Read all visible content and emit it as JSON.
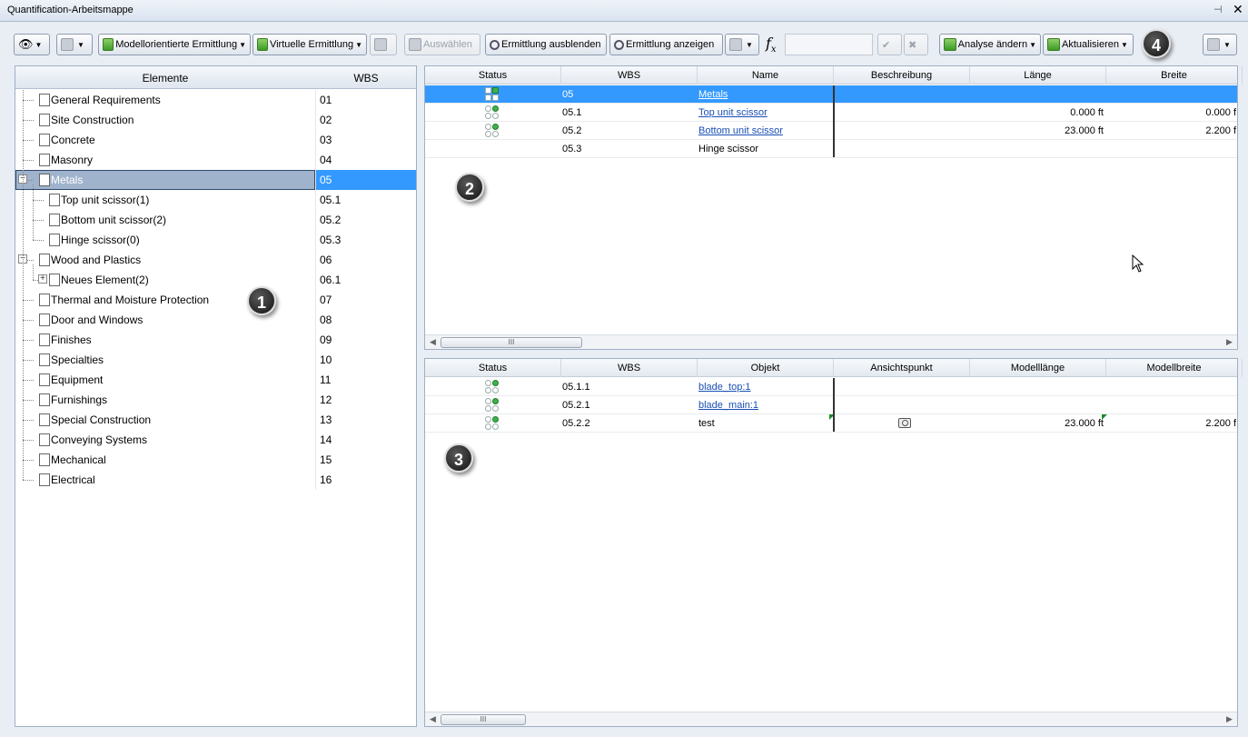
{
  "window": {
    "title": "Quantification-Arbeitsmappe",
    "pin_icon": "pin-icon",
    "close_label": "✕"
  },
  "toolbar": {
    "modellorientiert_label": "Modellorientierte Ermittlung",
    "virtuell_label": "Virtuelle Ermittlung",
    "auswaehlen_label": "Auswählen",
    "ausblenden_label": "Ermittlung ausblenden",
    "anzeigen_label": "Ermittlung anzeigen",
    "formula_symbol": "fx",
    "formula_value": "",
    "analyse_label": "Analyse ändern",
    "aktualisieren_label": "Aktualisieren"
  },
  "badges": [
    "1",
    "2",
    "3",
    "4"
  ],
  "tree": {
    "headers": {
      "name": "Elemente",
      "wbs": "WBS"
    },
    "items": [
      {
        "name": "General Requirements",
        "wbs": "01",
        "level": 0
      },
      {
        "name": "Site Construction",
        "wbs": "02",
        "level": 0
      },
      {
        "name": "Concrete",
        "wbs": "03",
        "level": 0
      },
      {
        "name": "Masonry",
        "wbs": "04",
        "level": 0
      },
      {
        "name": "Metals",
        "wbs": "05",
        "level": 0,
        "selected": true,
        "expander": "−"
      },
      {
        "name": "Top unit scissor(1)",
        "wbs": "05.1",
        "level": 1
      },
      {
        "name": "Bottom unit scissor(2)",
        "wbs": "05.2",
        "level": 1
      },
      {
        "name": "Hinge scissor(0)",
        "wbs": "05.3",
        "level": 1
      },
      {
        "name": "Wood and Plastics",
        "wbs": "06",
        "level": 0,
        "expander": "−"
      },
      {
        "name": "Neues Element(2)",
        "wbs": "06.1",
        "level": 1,
        "expander": "+"
      },
      {
        "name": "Thermal and Moisture Protection",
        "wbs": "07",
        "level": 0
      },
      {
        "name": "Door and Windows",
        "wbs": "08",
        "level": 0
      },
      {
        "name": "Finishes",
        "wbs": "09",
        "level": 0
      },
      {
        "name": "Specialties",
        "wbs": "10",
        "level": 0
      },
      {
        "name": "Equipment",
        "wbs": "11",
        "level": 0
      },
      {
        "name": "Furnishings",
        "wbs": "12",
        "level": 0
      },
      {
        "name": "Special Construction",
        "wbs": "13",
        "level": 0
      },
      {
        "name": "Conveying Systems",
        "wbs": "14",
        "level": 0
      },
      {
        "name": "Mechanical",
        "wbs": "15",
        "level": 0
      },
      {
        "name": "Electrical",
        "wbs": "16",
        "level": 0
      }
    ]
  },
  "items_grid": {
    "headers": [
      "Status",
      "WBS",
      "Name",
      "Beschreibung",
      "Länge",
      "Breite"
    ],
    "rows": [
      {
        "wbs": "05",
        "name": "Metals",
        "link": true,
        "beschreibung": "",
        "laenge": "",
        "breite": "",
        "selected": true,
        "status": "group"
      },
      {
        "wbs": "05.1",
        "name": "Top unit scissor",
        "link": true,
        "beschreibung": "",
        "laenge": "0.000 ft",
        "breite": "0.000 f",
        "status": "partial"
      },
      {
        "wbs": "05.2",
        "name": "Bottom unit scissor",
        "link": true,
        "beschreibung": "",
        "laenge": "23.000 ft",
        "breite": "2.200 f",
        "status": "partial"
      },
      {
        "wbs": "05.3",
        "name": "Hinge scissor",
        "link": false,
        "beschreibung": "",
        "laenge": "",
        "breite": "",
        "status": "none"
      }
    ]
  },
  "objects_grid": {
    "headers": [
      "Status",
      "WBS",
      "Objekt",
      "Ansichtspunkt",
      "Modelllänge",
      "Modellbreite"
    ],
    "rows": [
      {
        "wbs": "05.1.1",
        "objekt": "blade_top:1",
        "link": true,
        "camera": false,
        "laenge": "",
        "breite": ""
      },
      {
        "wbs": "05.2.1",
        "objekt": "blade_main:1",
        "link": true,
        "camera": false,
        "laenge": "",
        "breite": ""
      },
      {
        "wbs": "05.2.2",
        "objekt": "test",
        "link": false,
        "camera": true,
        "laenge": "23.000 ft",
        "breite": "2.200 f"
      }
    ]
  },
  "scrollbar_grip": "III",
  "colors": {
    "selection": "#3399ff",
    "selection_tree": "#9fb3cc",
    "link": "#1a4fb5",
    "status_green": "#3fb24a"
  }
}
